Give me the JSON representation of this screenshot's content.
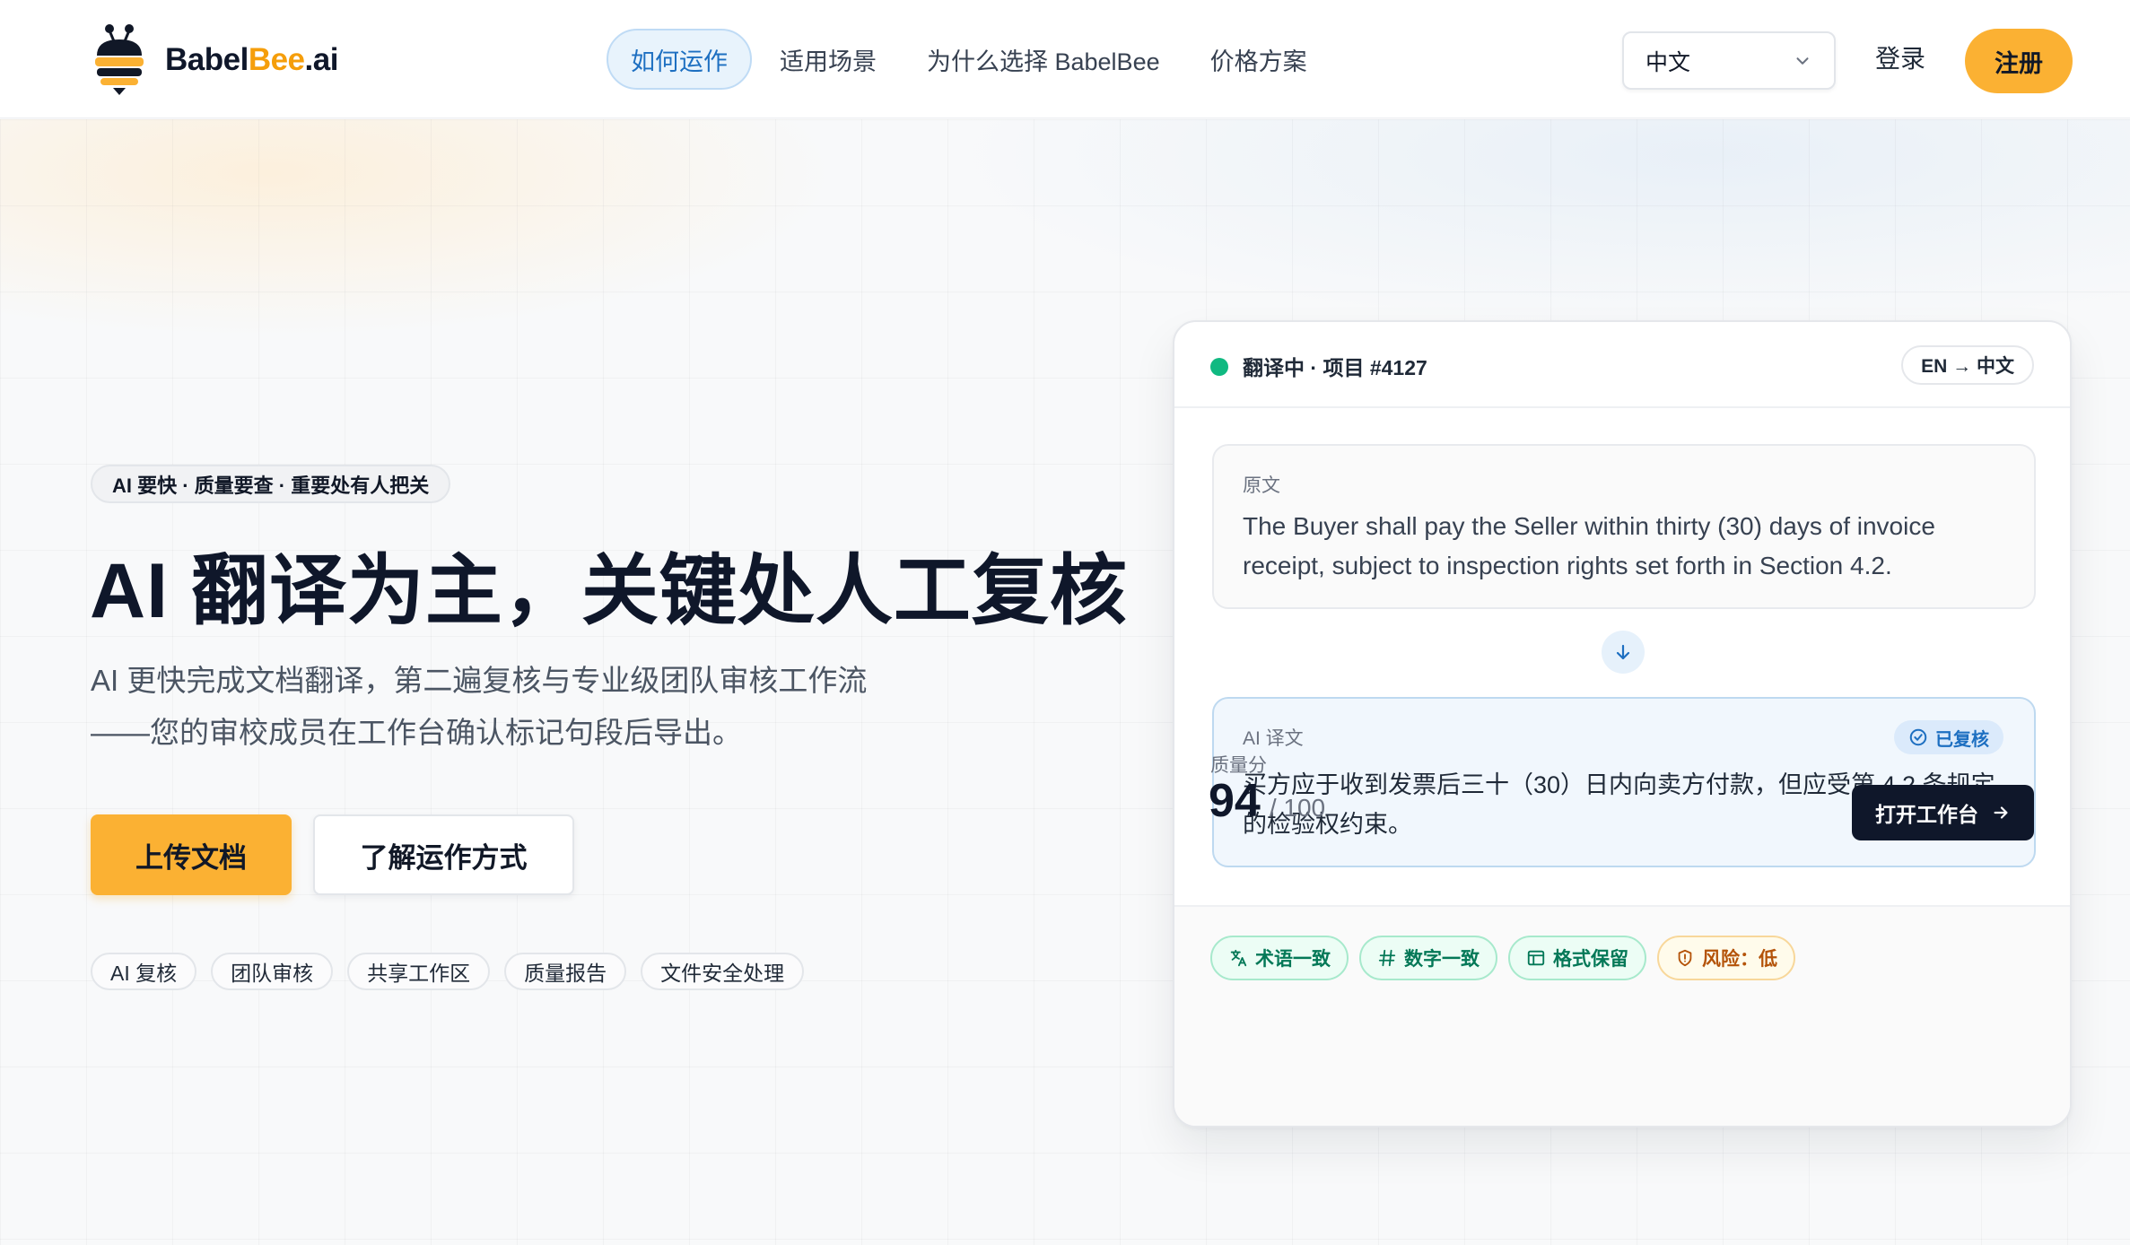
{
  "brand": {
    "name_part1": "Babel",
    "name_part2": "Bee",
    "name_part3": ".ai",
    "accent_color": "#fbb133"
  },
  "nav": {
    "items": [
      {
        "label": "如何运作",
        "active": true
      },
      {
        "label": "适用场景"
      },
      {
        "label": "为什么选择 BabelBee"
      },
      {
        "label": "价格方案"
      }
    ]
  },
  "header": {
    "language_selected": "中文",
    "login_label": "登录",
    "signup_label": "注册"
  },
  "hero": {
    "eyebrow": "AI 要快 · 质量要查 · 重要处有人把关",
    "headline": "AI 翻译为主，关键处人工复核",
    "subtitle_line1": "AI 更快完成文档翻译，第二遍复核与专业级团队审核工作流",
    "subtitle_line2": "——您的审校成员在工作台确认标记句段后导出。",
    "primary_button": "上传文档",
    "secondary_button": "了解运作方式",
    "chips": [
      "AI 复核",
      "团队审核",
      "共享工作区",
      "质量报告",
      "文件安全处理"
    ]
  },
  "card": {
    "status": "翻译中 · 项目 #4127",
    "status_color": "#10b981",
    "language_pair": "EN → 中文",
    "source_label": "原文",
    "source_text": "The Buyer shall pay the Seller within thirty (30) days of invoice receipt, subject to inspection rights set forth in Section 4.2.",
    "ai_label": "AI 译文",
    "reviewed_badge": "已复核",
    "ai_text": "买方应于收到发票后三十（30）日内向卖方付款，但应受第 4.2 条规定的检验权约束。",
    "tags": [
      {
        "label": "术语一致",
        "icon": "translate-icon",
        "tone": "green"
      },
      {
        "label": "数字一致",
        "icon": "hash-icon",
        "tone": "green"
      },
      {
        "label": "格式保留",
        "icon": "layout-icon",
        "tone": "green"
      },
      {
        "label": "风险：低",
        "icon": "shield-icon",
        "tone": "amber"
      }
    ],
    "quality_label": "质量分",
    "quality_score": "94",
    "quality_max": "/ 100",
    "open_button": "打开工作台"
  }
}
